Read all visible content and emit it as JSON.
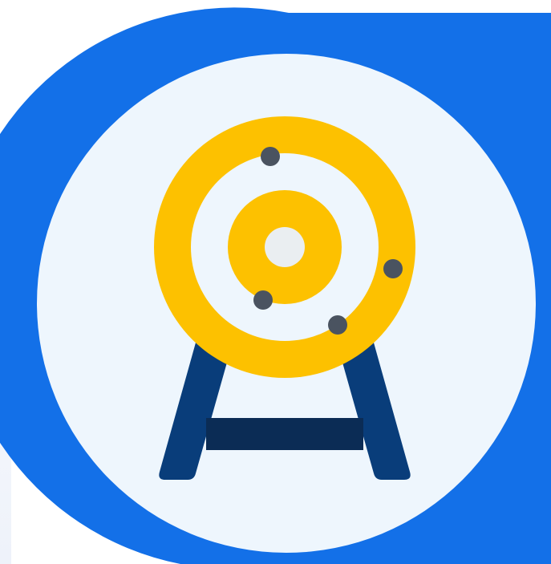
{
  "colors": {
    "page_background": "#ffffff",
    "badge_blue": "#1370e8",
    "badge_inner": "#eef6fd",
    "target_yellow": "#fdc100",
    "target_center": "#eaeef1",
    "stand_blue": "#093d7a",
    "stand_crossbar": "#0b2c55",
    "arrow_hole": "#4a5360"
  },
  "icon": {
    "name": "target-icon",
    "description_name": "archery-target-on-stand",
    "arrow_hit_count": 4
  }
}
